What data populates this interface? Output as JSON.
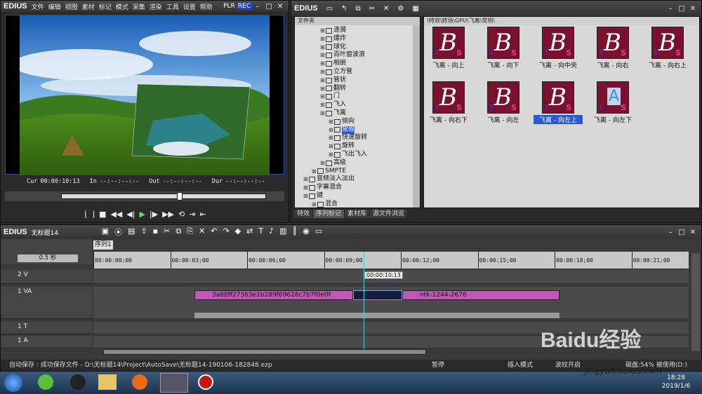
{
  "player": {
    "logo": "EDIUS",
    "menus": [
      "文件",
      "编辑",
      "视图",
      "素材",
      "标记",
      "模式",
      "采集",
      "渲染",
      "工具",
      "设置",
      "帮助"
    ],
    "plr": "PLR",
    "rec": "REC",
    "cur_label": "Cur",
    "cur_value": "00:00:10:13",
    "in_label": "In",
    "in_value": "--:--:--:--",
    "out_label": "Out",
    "out_value": "--:--:--:--",
    "dur_label": "Dur",
    "dur_value": "--:--:--:--"
  },
  "browser": {
    "logo": "EDIUS",
    "folder_header": "文件夹",
    "path": "\\特效\\转场\\GPU\\飞离\\常规\\",
    "tree": [
      {
        "label": "涟漪",
        "depth": 3
      },
      {
        "label": "爆炸",
        "depth": 3
      },
      {
        "label": "球化",
        "depth": 3
      },
      {
        "label": "百叶窗波浪",
        "depth": 3
      },
      {
        "label": "相册",
        "depth": 3
      },
      {
        "label": "立方管",
        "depth": 3
      },
      {
        "label": "管状",
        "depth": 3
      },
      {
        "label": "翻转",
        "depth": 3
      },
      {
        "label": "门",
        "depth": 3
      },
      {
        "label": "飞入",
        "depth": 3
      },
      {
        "label": "飞离",
        "depth": 3
      },
      {
        "label": "侧向",
        "depth": 4
      },
      {
        "label": "常规",
        "depth": 4,
        "selected": true
      },
      {
        "label": "快速旋转",
        "depth": 4
      },
      {
        "label": "旋转",
        "depth": 4
      },
      {
        "label": "飞出飞入",
        "depth": 4
      },
      {
        "label": "高级",
        "depth": 3
      },
      {
        "label": "SMPTE",
        "depth": 2
      },
      {
        "label": "音频淡入淡出",
        "depth": 1
      },
      {
        "label": "字幕混合",
        "depth": 1
      },
      {
        "label": "键",
        "depth": 1
      },
      {
        "label": "混合",
        "depth": 2
      }
    ],
    "items": [
      "飞离 - 向上",
      "飞离 - 向下",
      "飞离 - 向中央",
      "飞离 - 向右",
      "飞离 - 向右上",
      "飞离 - 向右下",
      "飞离 - 向左",
      "飞离 - 向左上",
      "飞离 - 向左下"
    ],
    "selected_item": "飞离 - 向左上",
    "tabs": [
      "特效",
      "序列标记",
      "素材库",
      "源文件浏览"
    ]
  },
  "timeline": {
    "logo": "EDIUS",
    "project": "无标题14",
    "sequence_tab": "序列1",
    "zoom": "0.5 秒",
    "ruler": [
      "00:00:00;00",
      "00:00:03;00",
      "00:00:06;00",
      "00:00:09;00",
      "00:00:12;00",
      "00:00:15;00",
      "00:00:18;00",
      "00:00:21;00"
    ],
    "playhead_time": "00:00:10:13",
    "tracks": [
      {
        "name": "2 V"
      },
      {
        "name": "1 VA"
      },
      {
        "name": "1 T"
      },
      {
        "name": "1 A"
      }
    ],
    "clip1": "3a68ff27363e1b289f69628c7b7f0e0f",
    "clip2": "ntk-1244-2676"
  },
  "status": {
    "autosave": "自动保存 : 成功保存文件 - D:\\无标题14\\Project\\AutoSave\\无标题14-190106-182848.ezp",
    "pause": "暂停",
    "insert": "插入模式",
    "ripple": "波纹开启",
    "disk": "磁盘:54% 被使用(D:)"
  },
  "taskbar": {
    "time": "18:28",
    "date": "2019/1/6"
  },
  "watermark": {
    "brand": "Baidu经验",
    "url": "jingyan.baidu.com"
  }
}
